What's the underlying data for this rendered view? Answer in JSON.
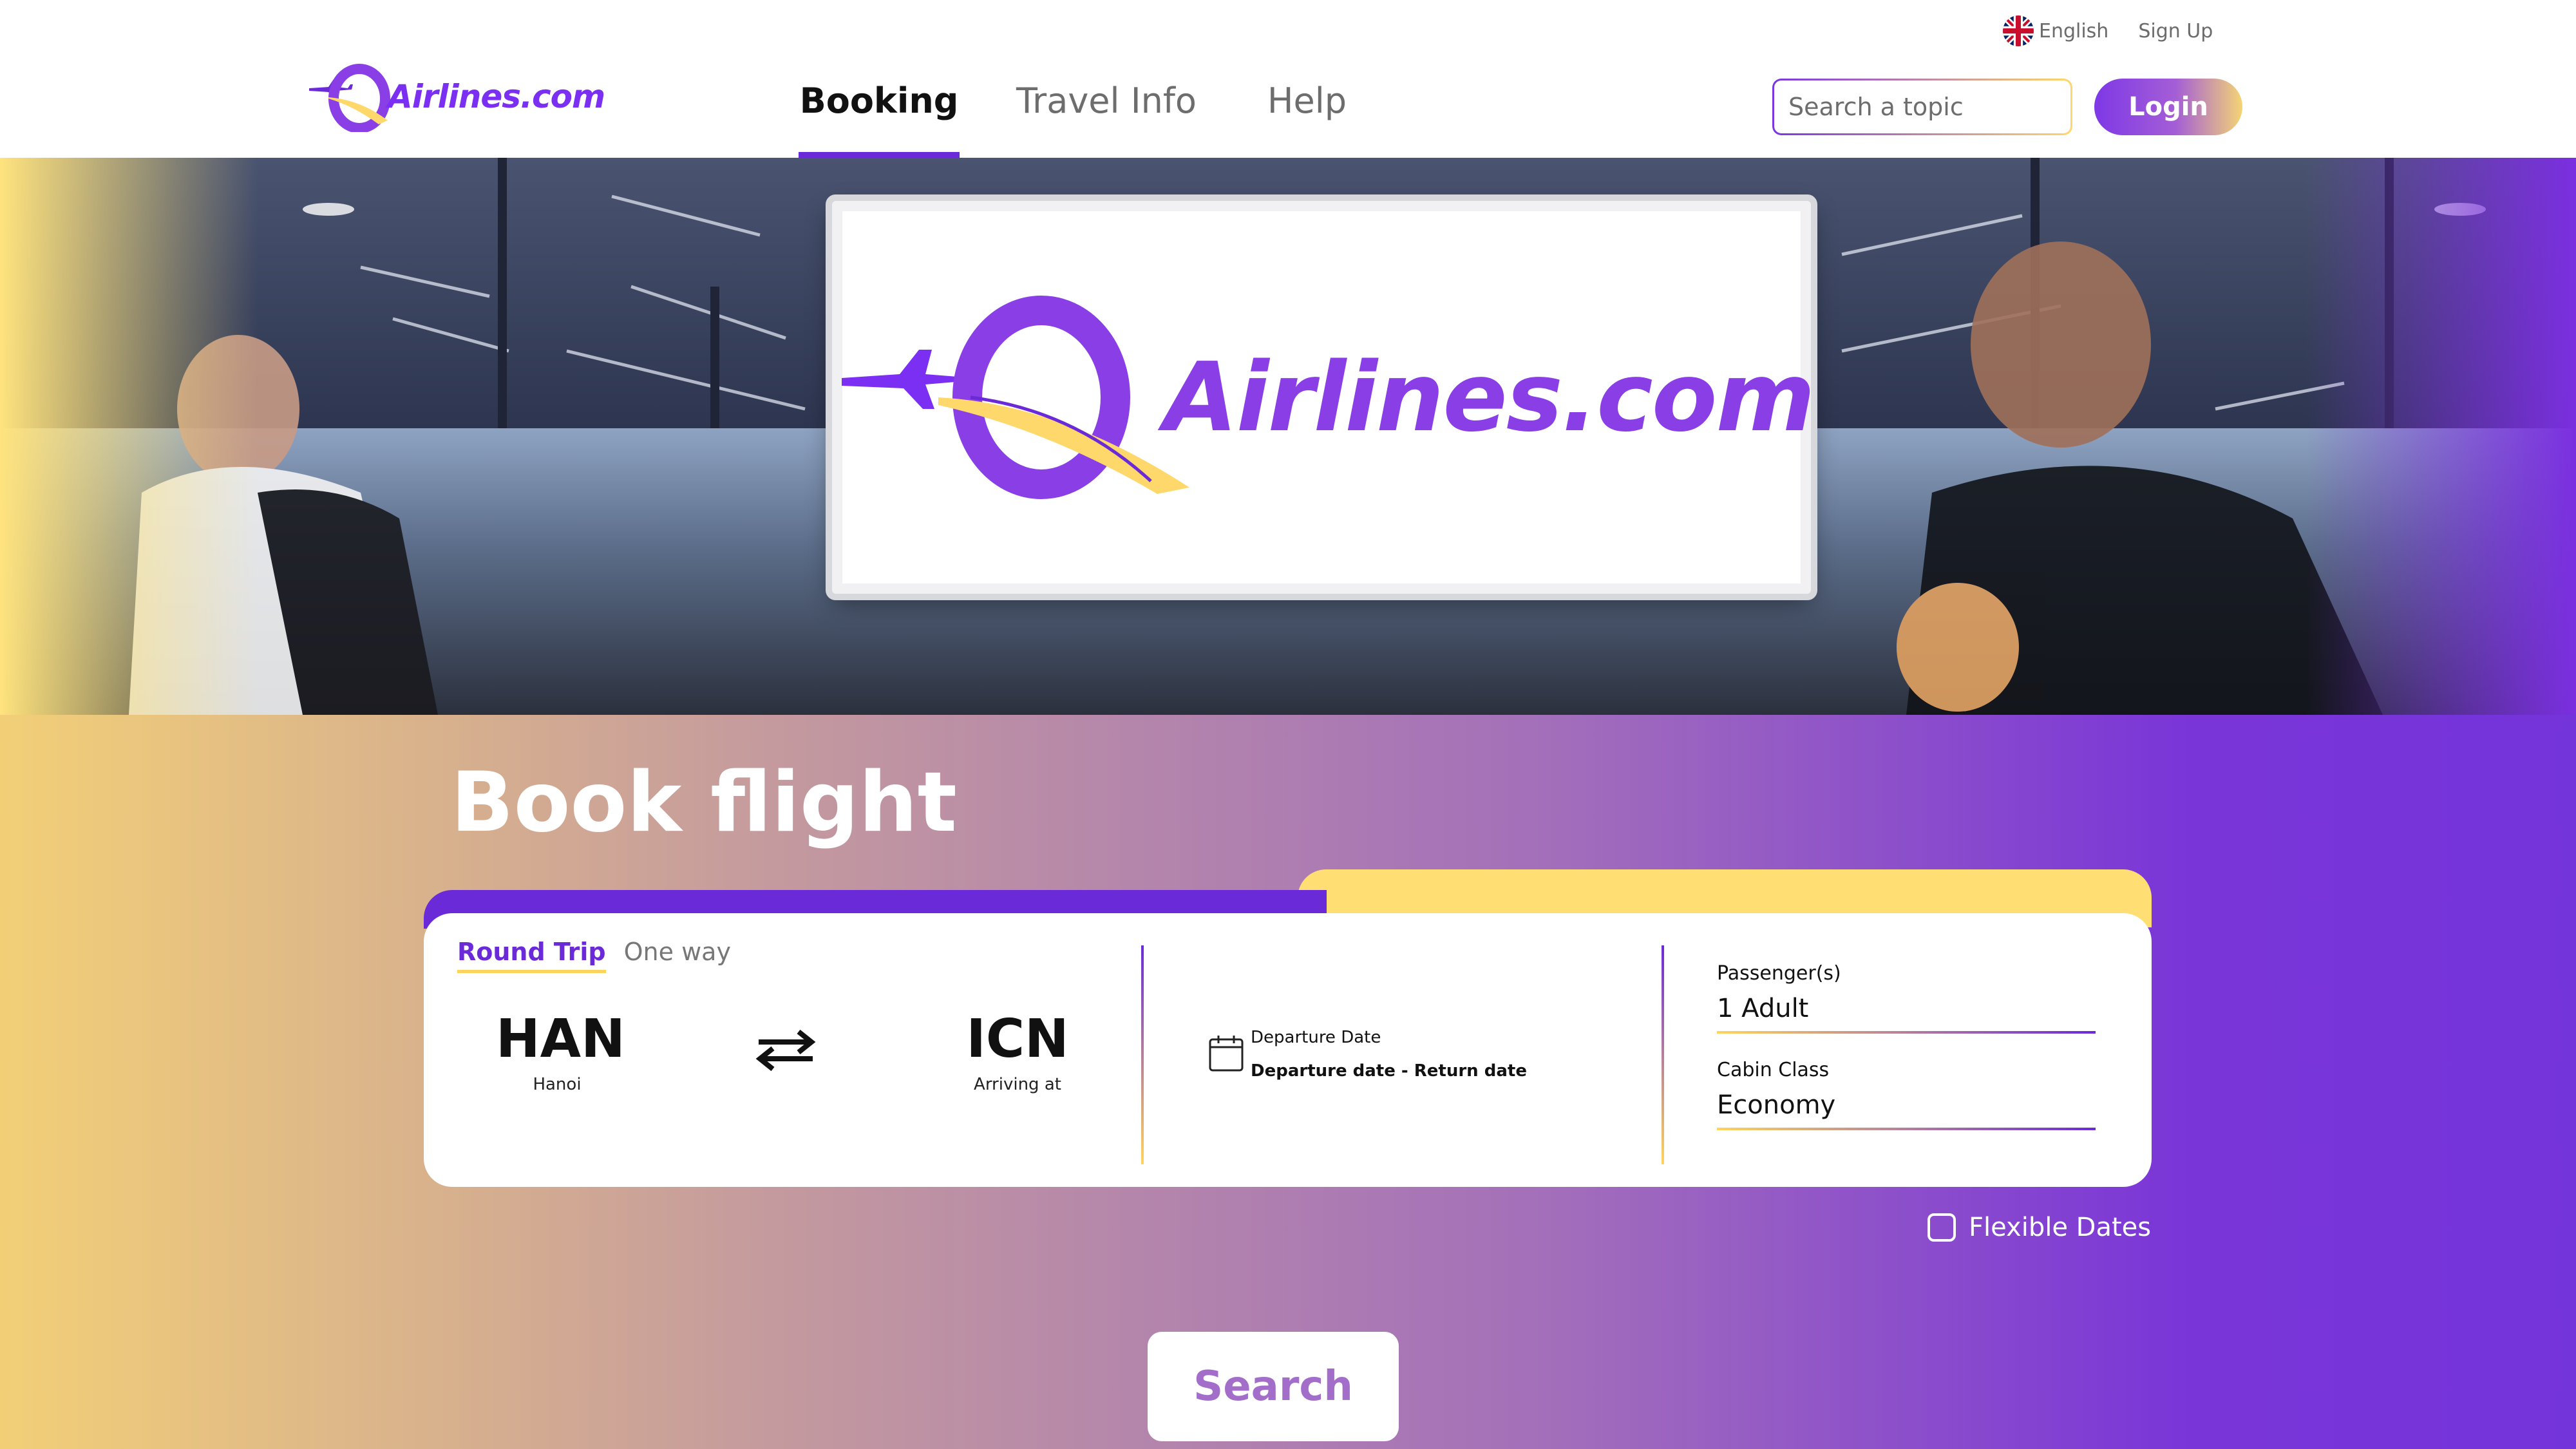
{
  "utility": {
    "language": "English",
    "signup": "Sign Up"
  },
  "brand": {
    "name": "Airlines.com",
    "billboard_name": "Airlines.com",
    "colors": {
      "primary": "#6a2ad8",
      "accent": "#ffd45c"
    }
  },
  "nav": {
    "items": [
      {
        "label": "Booking",
        "active": true
      },
      {
        "label": "Travel Info",
        "active": false
      },
      {
        "label": "Help",
        "active": false
      }
    ]
  },
  "search": {
    "placeholder": "Search a topic"
  },
  "login": {
    "label": "Login"
  },
  "booking": {
    "title": "Book flight",
    "trip_types": [
      {
        "label": "Round Trip",
        "active": true
      },
      {
        "label": "One way",
        "active": false
      }
    ],
    "origin": {
      "code": "HAN",
      "name": "Hanoi"
    },
    "destination": {
      "code": "ICN",
      "name": "Arriving at"
    },
    "dates": {
      "label": "Departure Date",
      "value": "Departure date - Return date"
    },
    "passengers": {
      "label": "Passenger(s)",
      "value": "1 Adult"
    },
    "cabin": {
      "label": "Cabin Class",
      "value": "Economy"
    },
    "flexible": {
      "label": "Flexible Dates",
      "checked": false
    },
    "search_label": "Search"
  },
  "icons": {
    "flag": "uk-flag-icon",
    "plane": "plane-icon",
    "swap": "swap-arrows-icon",
    "calendar": "calendar-icon",
    "checkbox": "checkbox-icon"
  }
}
